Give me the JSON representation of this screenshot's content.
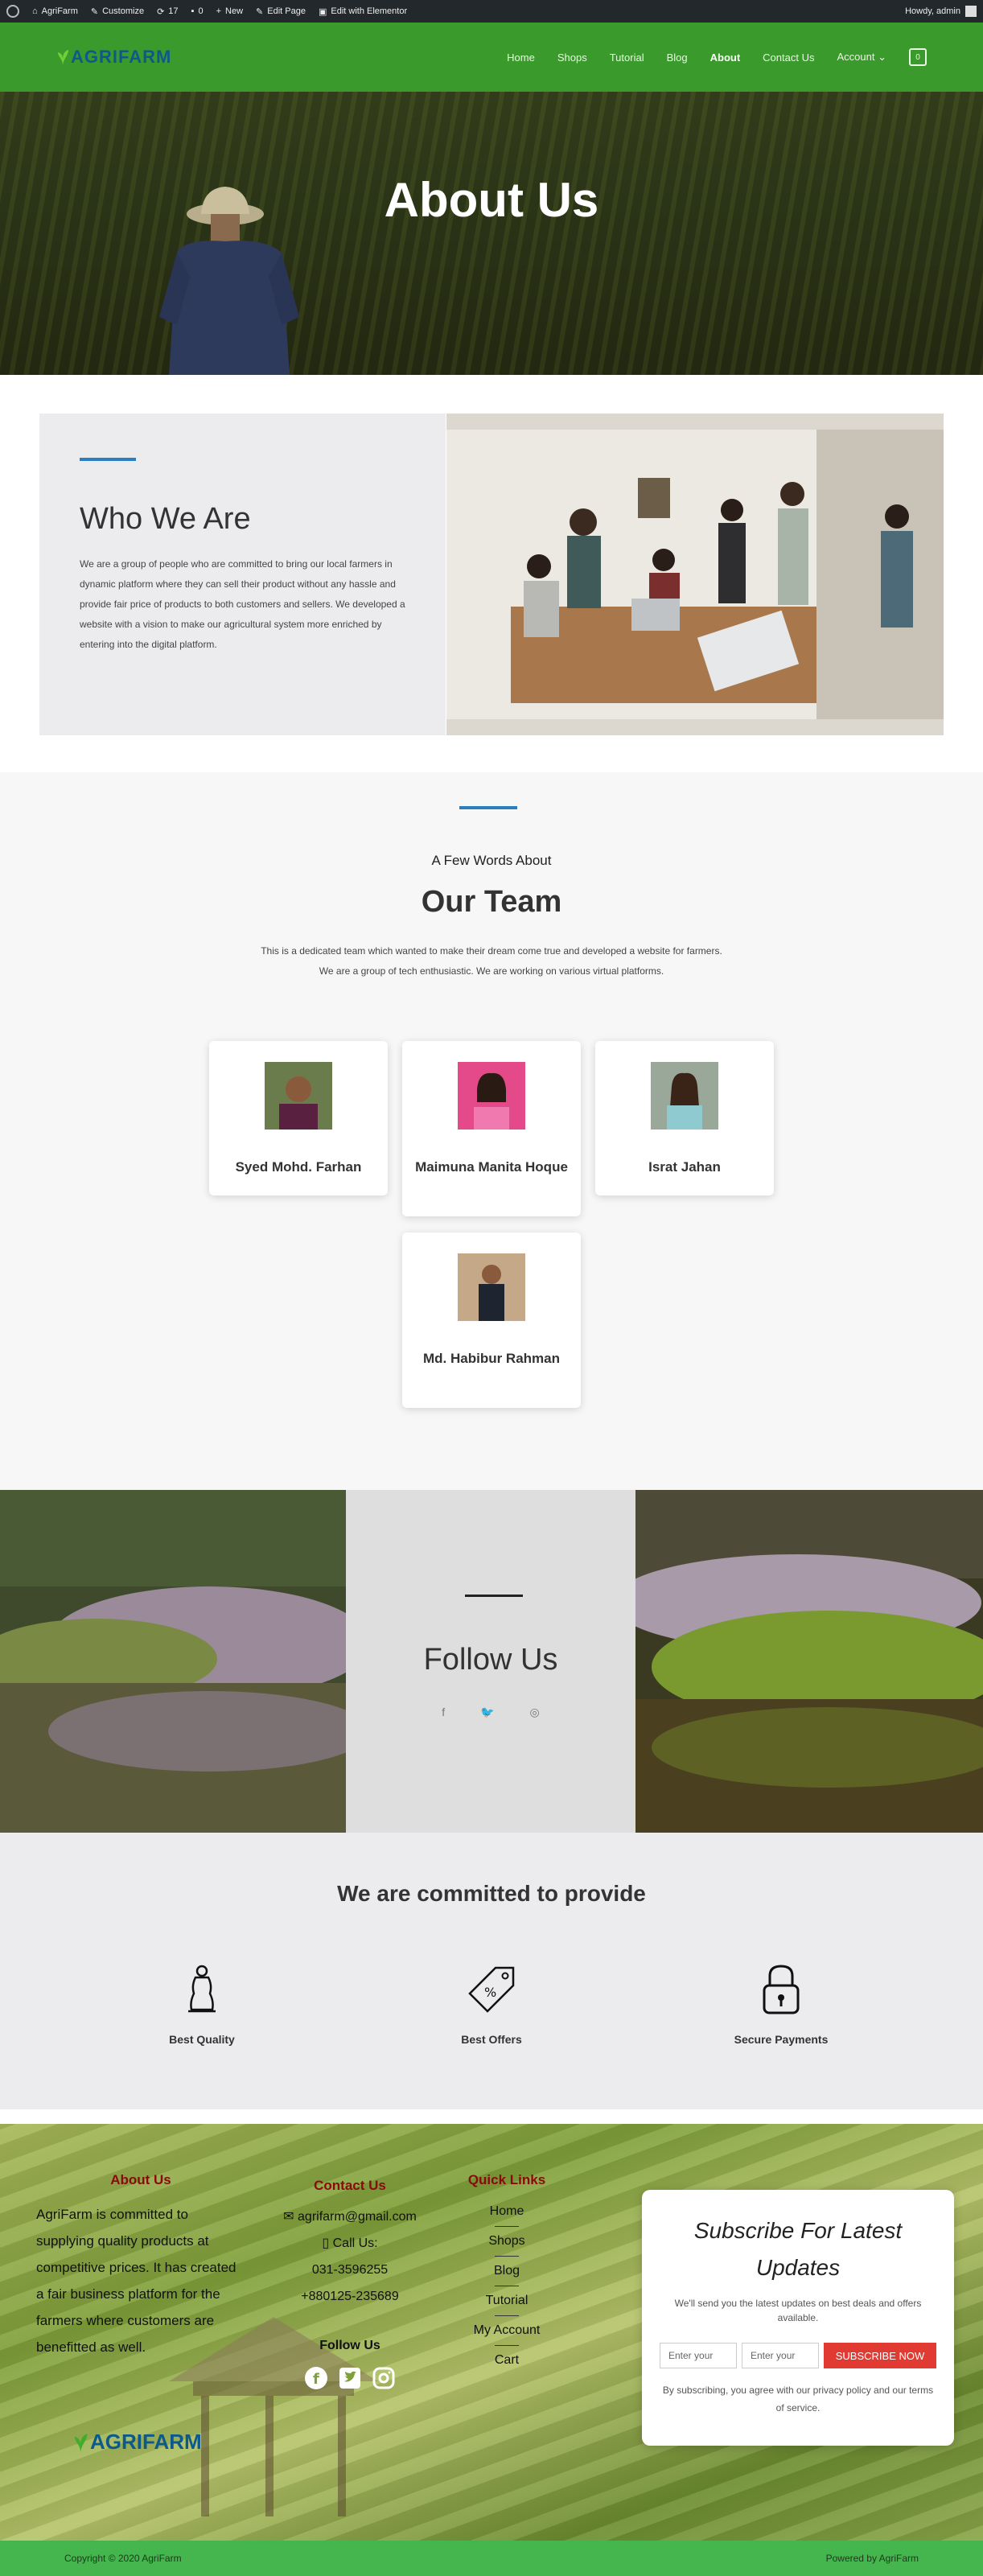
{
  "admin_bar": {
    "site": "AgriFarm",
    "customize": "Customize",
    "updates": "17",
    "comments": "0",
    "new": "New",
    "edit_page": "Edit Page",
    "edit_elementor": "Edit with Elementor",
    "howdy": "Howdy, admin"
  },
  "header": {
    "logo": "AGRIFARM",
    "nav": [
      "Home",
      "Shops",
      "Tutorial",
      "Blog",
      "About",
      "Contact Us",
      "Account"
    ],
    "active": "About",
    "cart_count": "0"
  },
  "hero": {
    "title": "About Us"
  },
  "who": {
    "title": "Who We Are",
    "text": "We are a group of people who are committed to bring our local farmers in dynamic platform where they can sell their product without any hassle and provide fair price of products to both customers and sellers. We developed a website with a vision to make our agricultural system more enriched by entering into the digital platform."
  },
  "team": {
    "subtitle": "A Few Words About",
    "title": "Our Team",
    "desc_line1": "This is a dedicated team which wanted to make their dream come true and developed a website for farmers.",
    "desc_line2": "We are a group of tech enthusiastic. We are working on various virtual platforms.",
    "members": [
      {
        "name": "Syed Mohd. Farhan"
      },
      {
        "name": "Maimuna Manita Hoque"
      },
      {
        "name": "Israt Jahan"
      },
      {
        "name": "Md. Habibur Rahman"
      }
    ]
  },
  "follow": {
    "title": "Follow Us",
    "icons": [
      "facebook-icon",
      "twitter-icon",
      "instagram-icon"
    ]
  },
  "commit": {
    "title": "We are committed to provide",
    "features": [
      "Best Quality",
      "Best Offers",
      "Secure Payments"
    ]
  },
  "footer": {
    "about_title": "About Us",
    "about_text": "AgriFarm is committed to supplying quality products at competitive prices. It has created a fair business platform for the farmers where customers are benefitted as well.",
    "contact_title": "Contact Us",
    "email": "agrifarm@gmail.com",
    "call_label": "Call Us:",
    "phone1": "031-3596255",
    "phone2": "+880125-235689",
    "follow_label": "Follow Us",
    "links_title": "Quick Links",
    "links": [
      "Home",
      "Shops",
      "Blog",
      "Tutorial",
      "My Account",
      "Cart"
    ],
    "logo": "AGRIFARM",
    "subscribe_title": "Subscribe For Latest Updates",
    "subscribe_lead": "We'll send you the latest updates on best deals and offers available.",
    "input1_placeholder": "Enter your",
    "input2_placeholder": "Enter your",
    "subscribe_button": "SUBSCRIBE NOW",
    "terms": "By subscribing, you agree with our privacy policy and our terms of service.",
    "copyright": "Copyright © 2020 AgriFarm",
    "powered": "Powered by AgriFarm"
  },
  "colors": {
    "brand_green": "#3a9a2c",
    "accent_blue": "#2a7fc0",
    "cta_red": "#e03a33",
    "footer_bar": "#45b64e"
  }
}
